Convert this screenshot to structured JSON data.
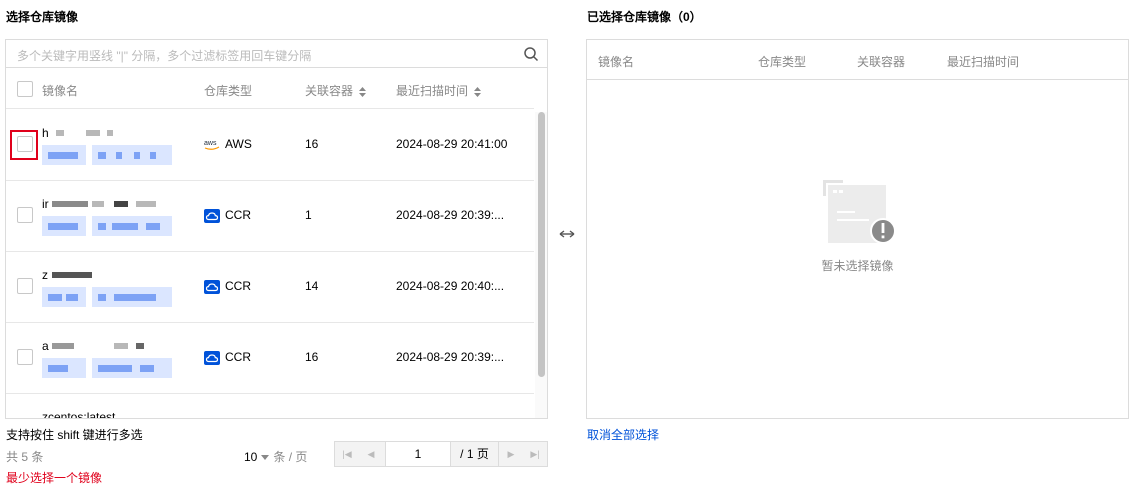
{
  "left_title": "选择仓库镜像",
  "right_title": "已选择仓库镜像（0）",
  "search": {
    "placeholder": "多个关键字用竖线 \"|\" 分隔，多个过滤标签用回车键分隔",
    "icon": "search-icon"
  },
  "columns": {
    "name": "镜像名",
    "repo_type": "仓库类型",
    "containers": "关联容器",
    "last_scan": "最近扫描时间"
  },
  "rows": [
    {
      "name_prefix": "h",
      "repo_type": "AWS",
      "repo_icon": "aws-icon",
      "containers": "16",
      "last_scan": "2024-08-29 20:41:00"
    },
    {
      "name_prefix": "ir",
      "repo_type": "CCR",
      "repo_icon": "ccr-cloud-icon",
      "containers": "1",
      "last_scan": "2024-08-29 20:39:..."
    },
    {
      "name_prefix": "z",
      "repo_type": "CCR",
      "repo_icon": "ccr-cloud-icon",
      "containers": "14",
      "last_scan": "2024-08-29 20:40:..."
    },
    {
      "name_prefix": "a",
      "repo_type": "CCR",
      "repo_icon": "ccr-cloud-icon",
      "containers": "16",
      "last_scan": "2024-08-29 20:39:..."
    }
  ],
  "partial_row_name": "zcentos:latest",
  "hint": "支持按住 shift 键进行多选",
  "total": "共 5 条",
  "page_size": "10",
  "page_size_unit": "条 / 页",
  "page_current": "1",
  "page_total": "/ 1 页",
  "error": "最少选择一个镜像",
  "right_columns": {
    "name": "镜像名",
    "repo_type": "仓库类型",
    "containers": "关联容器",
    "last_scan": "最近扫描时间"
  },
  "empty_text": "暂未选择镜像",
  "cancel_all": "取消全部选择",
  "colors": {
    "accent": "#0052d9",
    "error": "#e0001b",
    "border": "#dcdcdc"
  }
}
